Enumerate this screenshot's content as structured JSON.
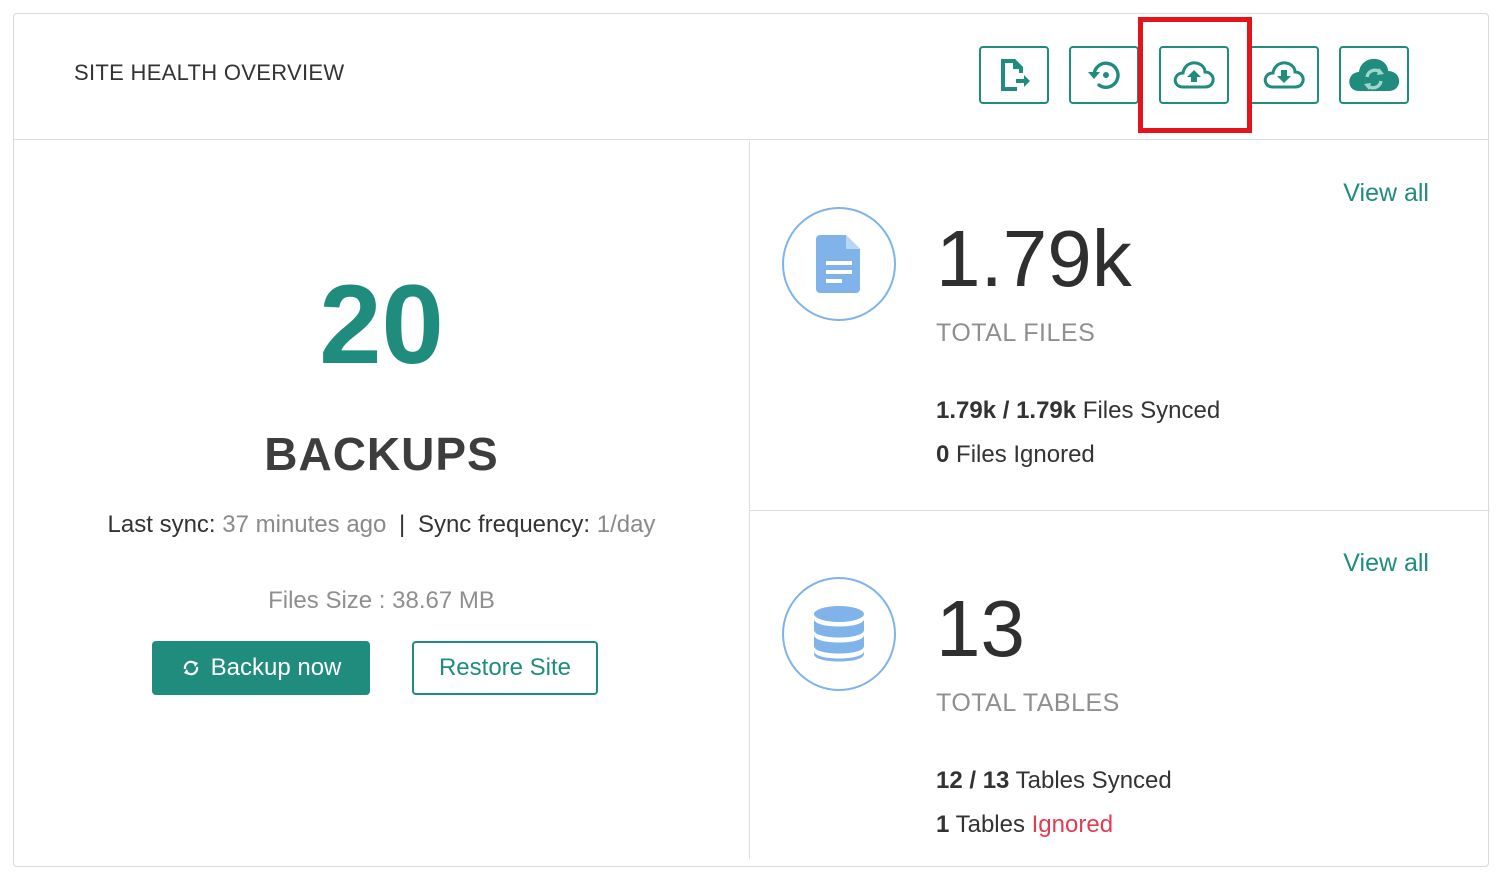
{
  "header": {
    "title": "SITE HEALTH OVERVIEW",
    "tools": [
      {
        "icon": "file-export-icon"
      },
      {
        "icon": "restore-history-icon"
      },
      {
        "icon": "cloud-upload-icon"
      },
      {
        "icon": "cloud-download-icon"
      },
      {
        "icon": "cloud-sync-icon"
      }
    ]
  },
  "backups": {
    "count": "20",
    "label": "BACKUPS",
    "last_sync_label": "Last sync:",
    "last_sync_value": "37 minutes ago",
    "separator": "|",
    "frequency_label": "Sync frequency:",
    "frequency_value": "1/day",
    "files_size": "Files Size : 38.67 MB",
    "backup_button": "Backup now",
    "restore_button": "Restore Site"
  },
  "files": {
    "view_all": "View all",
    "value": "1.79k",
    "label": "TOTAL FILES",
    "synced_count": "1.79k / 1.79k",
    "synced_text": "Files Synced",
    "ignored_count": "0",
    "ignored_text": "Files Ignored",
    "icon": "document-icon"
  },
  "tables": {
    "view_all": "View all",
    "value": "13",
    "label": "TOTAL TABLES",
    "synced_count": "12 / 13",
    "synced_text": "Tables Synced",
    "ignored_count": "1",
    "ignored_text_a": "Tables",
    "ignored_text_b": "Ignored",
    "icon": "database-icon"
  },
  "colors": {
    "accent": "#1f8c7e",
    "icon_blue": "#7fb3ea",
    "danger": "#e23b54",
    "highlight": "#e5131a"
  }
}
